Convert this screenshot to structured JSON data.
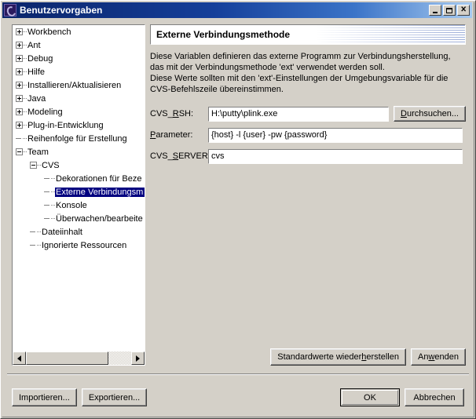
{
  "window": {
    "title": "Benutzervorgaben",
    "icon": "eclipse-icon",
    "minimize_label": "Minimieren",
    "maximize_label": "Maximieren",
    "close_label": "Schließen"
  },
  "tree": {
    "items": [
      {
        "label": "Workbench",
        "depth": 0,
        "state": "collapsed"
      },
      {
        "label": "Ant",
        "depth": 0,
        "state": "collapsed"
      },
      {
        "label": "Debug",
        "depth": 0,
        "state": "collapsed"
      },
      {
        "label": "Hilfe",
        "depth": 0,
        "state": "collapsed"
      },
      {
        "label": "Installieren/Aktualisieren",
        "depth": 0,
        "state": "collapsed"
      },
      {
        "label": "Java",
        "depth": 0,
        "state": "collapsed"
      },
      {
        "label": "Modeling",
        "depth": 0,
        "state": "collapsed"
      },
      {
        "label": "Plug-in-Entwicklung",
        "depth": 0,
        "state": "collapsed"
      },
      {
        "label": "Reihenfolge für Erstellung",
        "depth": 0,
        "state": "leaf"
      },
      {
        "label": "Team",
        "depth": 0,
        "state": "expanded"
      },
      {
        "label": "CVS",
        "depth": 1,
        "state": "expanded"
      },
      {
        "label": "Dekorationen für Beze",
        "depth": 2,
        "state": "leaf"
      },
      {
        "label": "Externe Verbindungsm",
        "depth": 2,
        "state": "leaf",
        "selected": true
      },
      {
        "label": "Konsole",
        "depth": 2,
        "state": "leaf"
      },
      {
        "label": "Überwachen/bearbeite",
        "depth": 2,
        "state": "leaf"
      },
      {
        "label": "Dateiinhalt",
        "depth": 1,
        "state": "leaf"
      },
      {
        "label": "Ignorierte Ressourcen",
        "depth": 1,
        "state": "leaf"
      }
    ],
    "scrollbar": {
      "left_arrow": "◀",
      "right_arrow": "▶"
    }
  },
  "page": {
    "title": "Externe Verbindungsmethode",
    "description": "Diese Variablen definieren das externe Programm zur Verbindungsherstellung, das mit der Verbindungsmethode 'ext' verwendet werden soll.\n Diese Werte sollten mit den 'ext'-Einstellungen der Umgebungsvariable für die CVS-Befehlszeile übereinstimmen.",
    "fields": [
      {
        "label_pre": "CVS_",
        "label_mnemonic": "R",
        "label_post": "SH:",
        "value": "H:\\putty\\plink.exe",
        "name": "cvs-rsh"
      },
      {
        "label_pre": "",
        "label_mnemonic": "P",
        "label_post": "arameter:",
        "value": "{host} -l {user} -pw {password}",
        "name": "parameter"
      },
      {
        "label_pre": "CVS_",
        "label_mnemonic": "S",
        "label_post": "ERVER:",
        "value": "cvs",
        "name": "cvs-server"
      }
    ],
    "browse_button": {
      "pre": "",
      "mnemonic": "D",
      "post": "urchsuchen..."
    },
    "restore_defaults_button": {
      "pre": "Standardwerte wieder",
      "mnemonic": "h",
      "post": "erstellen"
    },
    "apply_button": {
      "pre": "An",
      "mnemonic": "w",
      "post": "enden"
    }
  },
  "footer": {
    "import_label": "Importieren...",
    "export_label": "Exportieren...",
    "ok_label": "OK",
    "cancel_label": "Abbrechen"
  }
}
